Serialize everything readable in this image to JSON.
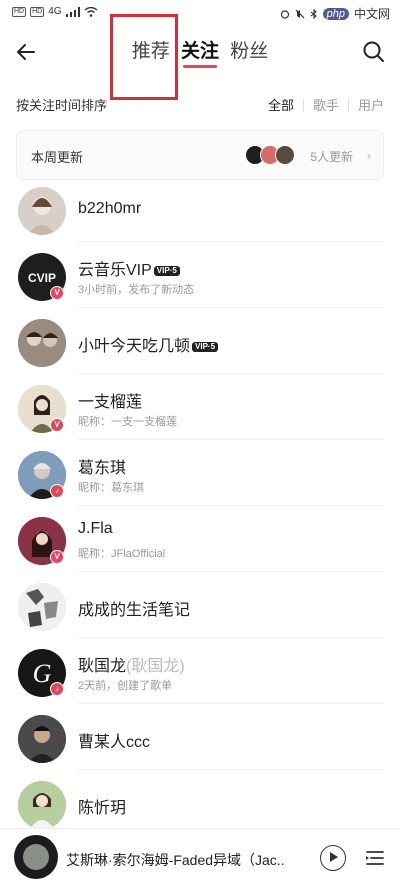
{
  "status_bar": {
    "left_text": "4G",
    "watermark": "php",
    "watermark_cn": "中文网"
  },
  "header": {
    "tabs": [
      {
        "label": "推荐",
        "active": false
      },
      {
        "label": "关注",
        "active": true
      },
      {
        "label": "粉丝",
        "active": false
      }
    ],
    "back_icon": "arrow-left-icon",
    "search_icon": "search-icon",
    "highlight_color": "#d32f3a"
  },
  "filter": {
    "title": "按关注时间排序",
    "options": [
      {
        "label": "全部",
        "selected": true
      },
      {
        "label": "歌手",
        "selected": false
      },
      {
        "label": "用户",
        "selected": false
      }
    ]
  },
  "weekly": {
    "label": "本周更新",
    "count_text": "5人更新"
  },
  "follows": [
    {
      "name": "b22h0mr",
      "subtitle": "",
      "vip": "",
      "alias": "",
      "badge": "",
      "avatar_color": "#d8cfc8"
    },
    {
      "name": "云音乐VIP",
      "subtitle": "3小时前，发布了新动态",
      "vip": "VIP·5",
      "alias": "",
      "badge": "V",
      "avatar_color": "#1e1e1e"
    },
    {
      "name": "小叶今天吃几顿",
      "subtitle": "",
      "vip": "VIP·5",
      "alias": "",
      "badge": "",
      "avatar_color": "#6b5a52"
    },
    {
      "name": "一支榴莲",
      "subtitle": "昵称：一支一支榴莲",
      "vip": "",
      "alias": "",
      "badge": "V",
      "avatar_color": "#c9b79c"
    },
    {
      "name": "葛东琪",
      "subtitle": "昵称：葛东琪",
      "vip": "",
      "alias": "",
      "badge": "♪",
      "avatar_color": "#6f8fb0"
    },
    {
      "name": "J.Fla",
      "subtitle": "昵称：JFlaOfficial",
      "vip": "",
      "alias": "",
      "badge": "V",
      "avatar_color": "#7b2e40"
    },
    {
      "name": "成成的生活笔记",
      "subtitle": "",
      "vip": "",
      "alias": "",
      "badge": "",
      "avatar_color": "#cfcfcf"
    },
    {
      "name": "耿国龙",
      "subtitle": "2天前，创建了歌单",
      "vip": "",
      "alias": "(耿国龙)",
      "badge": "♪",
      "avatar_color": "#161616"
    },
    {
      "name": "曹某人ccc",
      "subtitle": "",
      "vip": "",
      "alias": "",
      "badge": "",
      "avatar_color": "#3d3d3d"
    },
    {
      "name": "陈忻玥",
      "subtitle": "",
      "vip": "",
      "alias": "",
      "badge": "",
      "avatar_color": "#8fb07a"
    }
  ],
  "player": {
    "song": "艾斯琳·索尔海姆-Faded异域（Jac...",
    "play_icon": "play-icon",
    "queue_icon": "playlist-icon"
  }
}
